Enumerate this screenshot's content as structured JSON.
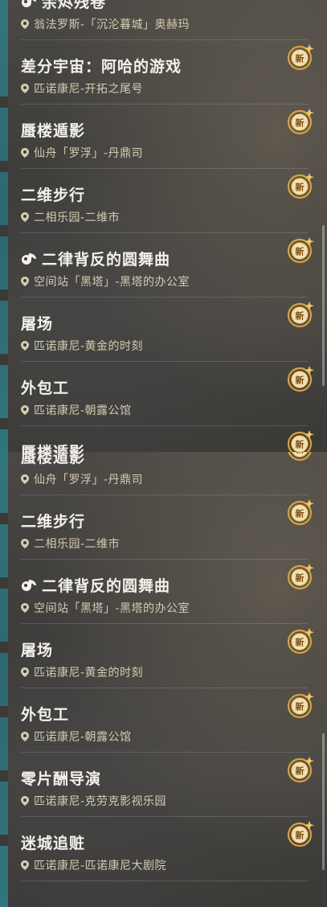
{
  "badge_label": "新",
  "colors": {
    "title": "#f3f1ea",
    "location": "#d6cbb2",
    "badge_gold": "#d9a23c",
    "edge_teal": "#2f7f8a"
  },
  "top_list": [
    {
      "title": "余烬残卷",
      "location": "翁法罗斯-「沉沦暮城」奥赫玛",
      "icon": "chess-piece-icon"
    },
    {
      "title": "差分宇宙：阿哈的游戏",
      "location": "匹诺康尼-开拓之尾号"
    },
    {
      "title": "蜃楼遁影",
      "location": "仙舟「罗浮」-丹鼎司"
    },
    {
      "title": "二维步行",
      "location": "二相乐园-二维市"
    },
    {
      "title": "二律背反的圆舞曲",
      "location": "空间站「黑塔」-黑塔的办公室",
      "icon": "chess-piece-icon"
    },
    {
      "title": "屠场",
      "location": "匹诺康尼-黄金的时刻"
    },
    {
      "title": "外包工",
      "location": "匹诺康尼-朝露公馆"
    },
    {
      "title": "蜃楼遁影",
      "location": "仙舟「罗浮」-丹鼎司"
    }
  ],
  "bottom_list": [
    {
      "title": "蜃楼遁影",
      "location": "仙舟「罗浮」-丹鼎司"
    },
    {
      "title": "二维步行",
      "location": "二相乐园-二维市"
    },
    {
      "title": "二律背反的圆舞曲",
      "location": "空间站「黑塔」-黑塔的办公室",
      "icon": "chess-piece-icon"
    },
    {
      "title": "屠场",
      "location": "匹诺康尼-黄金的时刻"
    },
    {
      "title": "外包工",
      "location": "匹诺康尼-朝露公馆"
    },
    {
      "title": "零片酬导演",
      "location": "匹诺康尼-克劳克影视乐园"
    },
    {
      "title": "迷城追赃",
      "location": "匹诺康尼-匹诺康尼大剧院"
    }
  ]
}
